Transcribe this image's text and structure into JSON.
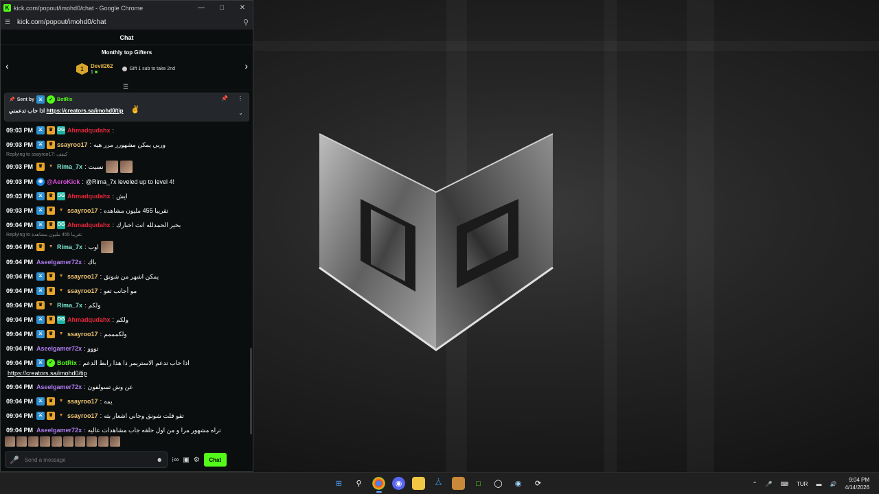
{
  "window": {
    "title": "kick.com/popout/imohd0/chat - Google Chrome",
    "url": "kick.com/popout/imohd0/chat",
    "favicon": "K"
  },
  "chat": {
    "header": "Chat",
    "gifters_title": "Monthly top Gifters",
    "top_gifter": {
      "rank": "1",
      "name": "Devil262",
      "count": "1"
    },
    "gift_hint": "Gift 1 sub to take 2nd"
  },
  "pinned": {
    "sent_by_label": "Sent by",
    "bot_name": "BotRix",
    "message_ar": "اذا حاب تدعمني",
    "link": "https://creators.sa/imohd0/tip"
  },
  "messages": [
    {
      "time": "09:03 PM",
      "user": "Ahmadqudahx",
      "color": "#e8283c",
      "badges": [
        "mod",
        "vip",
        "og"
      ],
      "text": ""
    },
    {
      "time": "09:03 PM",
      "user": "ssayroo17",
      "color": "#f0c674",
      "badges": [
        "mod",
        "vip"
      ],
      "text": "وربي يمكن مشهورر مرر هيه"
    },
    {
      "reply": "Replying to ssayroo17: كيفف",
      "time": "09:03 PM",
      "user": "Rima_7x",
      "color": "#7be8d4",
      "badges": [
        "vip",
        "sub"
      ],
      "text": "نسيت",
      "emotes": 2
    },
    {
      "time": "09:03 PM",
      "user": "@AeroKick",
      "color": "#d94fd9",
      "badges": [
        "bot"
      ],
      "text": "@Rima_7x leveled up to level 4!"
    },
    {
      "time": "09:03 PM",
      "user": "Ahmadqudahx",
      "color": "#e8283c",
      "badges": [
        "mod",
        "vip",
        "og"
      ],
      "text": "ايش"
    },
    {
      "time": "09:03 PM",
      "user": "ssayroo17",
      "color": "#f0c674",
      "badges": [
        "mod",
        "vip",
        "sub"
      ],
      "text": "تقريبا 455 مليون مشاهده"
    },
    {
      "time": "09:04 PM",
      "user": "Ahmadqudahx",
      "color": "#e8283c",
      "badges": [
        "mod",
        "vip",
        "og"
      ],
      "text": "بخير الحمدلله انت اخبارك"
    },
    {
      "reply": "Replying to تقريبا 455 مليون مشاهدة",
      "time": "09:04 PM",
      "user": "Rima_7x",
      "color": "#7be8d4",
      "badges": [
        "vip",
        "sub"
      ],
      "text": "اوب",
      "emotes": 1
    },
    {
      "time": "09:04 PM",
      "user": "Aseelgamer72x",
      "color": "#b07cf0",
      "badges": [],
      "text": "باك"
    },
    {
      "time": "09:04 PM",
      "user": "ssayroo17",
      "color": "#f0c674",
      "badges": [
        "mod",
        "vip",
        "sub"
      ],
      "text": "يمكن اشهر من شونق"
    },
    {
      "time": "09:04 PM",
      "user": "ssayroo17",
      "color": "#f0c674",
      "badges": [
        "mod",
        "vip",
        "sub"
      ],
      "text": "مو أجانب تعو"
    },
    {
      "time": "09:04 PM",
      "user": "Rima_7x",
      "color": "#7be8d4",
      "badges": [
        "vip",
        "sub"
      ],
      "text": "ولكم"
    },
    {
      "time": "09:04 PM",
      "user": "Ahmadqudahx",
      "color": "#e8283c",
      "badges": [
        "mod",
        "vip",
        "og"
      ],
      "text": "ولكم"
    },
    {
      "time": "09:04 PM",
      "user": "ssayroo17",
      "color": "#f0c674",
      "badges": [
        "mod",
        "vip",
        "sub"
      ],
      "text": "ولكمممم"
    },
    {
      "time": "09:04 PM",
      "user": "Aseelgamer72x",
      "color": "#b07cf0",
      "badges": [],
      "text": "تووو"
    },
    {
      "time": "09:04 PM",
      "user": "BotRix",
      "color": "#53fc18",
      "badges": [
        "mod",
        "verified"
      ],
      "text": "اذا حاب تدعم الاستريمر ذا هذا رابط الدعم",
      "link": "https://creators.sa/imohd0/tip"
    },
    {
      "time": "09:04 PM",
      "user": "Aseelgamer72x",
      "color": "#b07cf0",
      "badges": [],
      "text": "عن وش تسولفون"
    },
    {
      "time": "09:04 PM",
      "user": "ssayroo17",
      "color": "#f0c674",
      "badges": [
        "mod",
        "vip",
        "sub"
      ],
      "text": "يمه"
    },
    {
      "time": "09:04 PM",
      "user": "ssayroo17",
      "color": "#f0c674",
      "badges": [
        "mod",
        "vip",
        "sub"
      ],
      "text": "تقو قلت شونق وجاني اشعار بثه"
    },
    {
      "time": "09:04 PM",
      "user": "Aseelgamer72x",
      "color": "#b07cf0",
      "badges": [],
      "text": "تراه مشهور مرا و من اول حلقه جاب مشاهدات عاليه"
    }
  ],
  "composer": {
    "placeholder": "Send a message",
    "send_label": "Chat",
    "points_label": "∞"
  },
  "taskbar": {
    "language": "TUR",
    "time": "9:04 PM",
    "date": "4/14/2026"
  },
  "colors": {
    "kick_green": "#53fc18",
    "background": "#0b0e0f"
  }
}
